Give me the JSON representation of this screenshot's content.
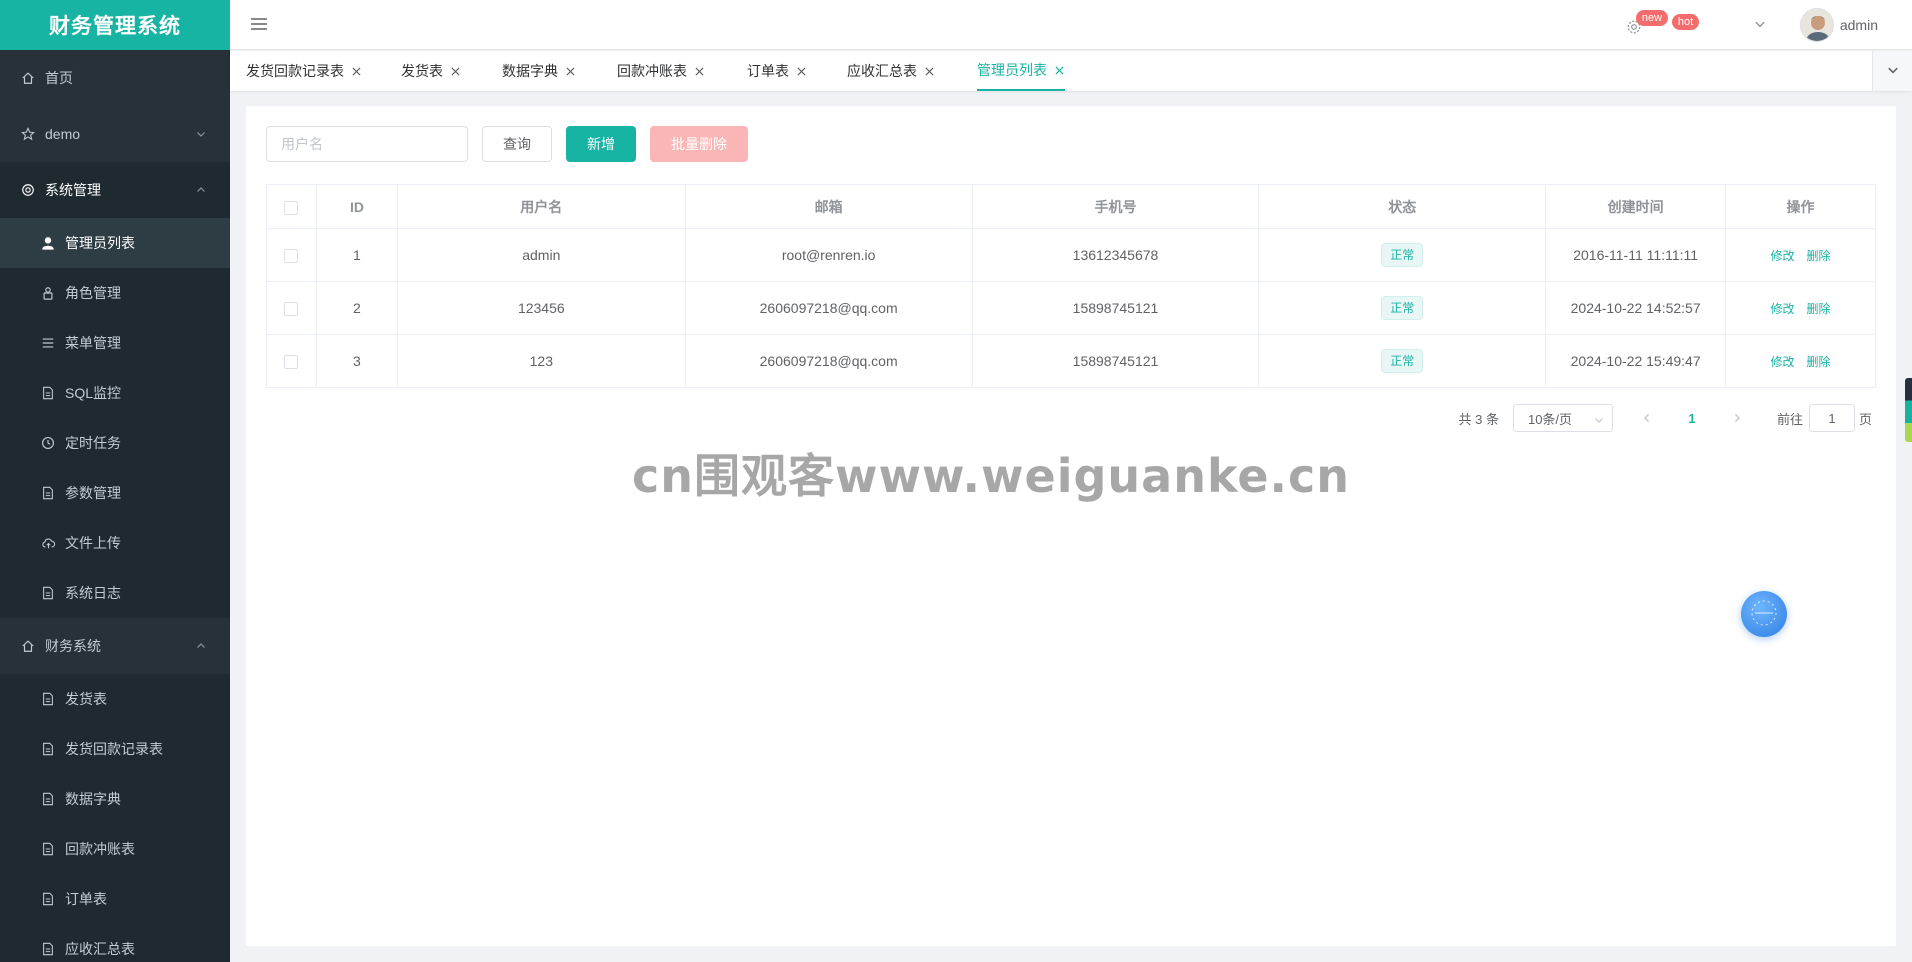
{
  "app": {
    "title": "财务管理系统"
  },
  "sidebar": {
    "items": [
      {
        "label": "首页",
        "icon": "home-icon"
      },
      {
        "label": "demo",
        "icon": "star-icon",
        "expand": "down"
      },
      {
        "label": "系统管理",
        "icon": "gear-icon",
        "expand": "up",
        "children": [
          {
            "label": "管理员列表",
            "icon": "user-icon",
            "active": true
          },
          {
            "label": "角色管理",
            "icon": "role-icon"
          },
          {
            "label": "菜单管理",
            "icon": "menu-list-icon"
          },
          {
            "label": "SQL监控",
            "icon": "document-icon"
          },
          {
            "label": "定时任务",
            "icon": "clock-icon"
          },
          {
            "label": "参数管理",
            "icon": "document-icon"
          },
          {
            "label": "文件上传",
            "icon": "cloud-upload-icon"
          },
          {
            "label": "系统日志",
            "icon": "document-icon"
          }
        ]
      },
      {
        "label": "财务系统",
        "icon": "home-icon",
        "expand": "up",
        "children": [
          {
            "label": "发货表",
            "icon": "document-icon"
          },
          {
            "label": "发货回款记录表",
            "icon": "document-icon"
          },
          {
            "label": "数据字典",
            "icon": "document-icon"
          },
          {
            "label": "回款冲账表",
            "icon": "document-icon"
          },
          {
            "label": "订单表",
            "icon": "document-icon"
          },
          {
            "label": "应收汇总表",
            "icon": "document-icon"
          }
        ]
      }
    ]
  },
  "header": {
    "badge_new": "new",
    "badge_hot": "hot",
    "username": "admin"
  },
  "tabs": [
    {
      "label": "发货回款记录表",
      "active": false
    },
    {
      "label": "发货表",
      "active": false
    },
    {
      "label": "数据字典",
      "active": false
    },
    {
      "label": "回款冲账表",
      "active": false
    },
    {
      "label": "订单表",
      "active": false
    },
    {
      "label": "应收汇总表",
      "active": false
    },
    {
      "label": "管理员列表",
      "active": true
    }
  ],
  "toolbar": {
    "search_placeholder": "用户名",
    "query_label": "查询",
    "add_label": "新增",
    "batch_delete_label": "批量删除"
  },
  "table": {
    "headers": [
      "ID",
      "用户名",
      "邮箱",
      "手机号",
      "状态",
      "创建时间",
      "操作"
    ],
    "rows": [
      {
        "id": "1",
        "username": "admin",
        "email": "root@renren.io",
        "mobile": "13612345678",
        "status": "正常",
        "created": "2016-11-11 11:11:11"
      },
      {
        "id": "2",
        "username": "123456",
        "email": "2606097218@qq.com",
        "mobile": "15898745121",
        "status": "正常",
        "created": "2024-10-22 14:52:57"
      },
      {
        "id": "3",
        "username": "123",
        "email": "2606097218@qq.com",
        "mobile": "15898745121",
        "status": "正常",
        "created": "2024-10-22 15:49:47"
      }
    ],
    "edit_label": "修改",
    "delete_label": "删除"
  },
  "pagination": {
    "total_text": "共 3 条",
    "page_size": "10条/页",
    "current_page": "1",
    "goto_prefix": "前往",
    "goto_value": "1",
    "goto_suffix": "页"
  },
  "watermark": "cn围观客www.weiguanke.cn",
  "colors": {
    "accent": "#17b3a3",
    "sidebar_bg": "#263238",
    "danger_light": "#fab6b6",
    "badge": "#f56c6c"
  }
}
